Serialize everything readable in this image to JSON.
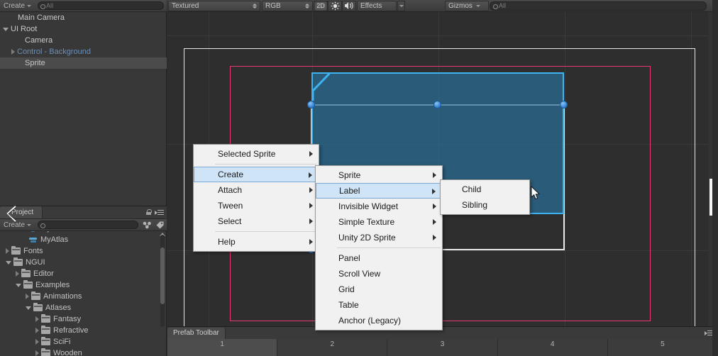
{
  "hierarchy": {
    "toolbar": {
      "create_label": "Create",
      "search_placeholder": "All"
    },
    "items": [
      {
        "label": "Main Camera",
        "indent": 14,
        "tri": "none",
        "selected": false,
        "prefab": false
      },
      {
        "label": "UI Root",
        "indent": 4,
        "tri": "down",
        "selected": false,
        "prefab": false
      },
      {
        "label": "Camera",
        "indent": 24,
        "tri": "none",
        "selected": false,
        "prefab": false
      },
      {
        "label": "Control - Background",
        "indent": 16,
        "tri": "right",
        "selected": false,
        "prefab": true
      },
      {
        "label": "Sprite",
        "indent": 24,
        "tri": "none",
        "selected": true,
        "prefab": false
      }
    ]
  },
  "project": {
    "tab_label": "Project",
    "toolbar": {
      "create_label": "Create",
      "search_placeholder": ""
    },
    "items": [
      {
        "label": "MyAtlas",
        "indent": 30,
        "tri": "none",
        "icon": "sphere",
        "clipped": true
      },
      {
        "label": "MyAtlas",
        "indent": 30,
        "tri": "none",
        "icon": "atlas",
        "clipped": false
      },
      {
        "label": "Fonts",
        "indent": 8,
        "tri": "right",
        "icon": "folder",
        "clipped": false
      },
      {
        "label": "NGUI",
        "indent": 8,
        "tri": "down",
        "icon": "folder",
        "clipped": false
      },
      {
        "label": "Editor",
        "indent": 22,
        "tri": "right",
        "icon": "folder",
        "clipped": false
      },
      {
        "label": "Examples",
        "indent": 22,
        "tri": "down",
        "icon": "folder",
        "clipped": false
      },
      {
        "label": "Animations",
        "indent": 36,
        "tri": "right",
        "icon": "folder",
        "clipped": false
      },
      {
        "label": "Atlases",
        "indent": 36,
        "tri": "down",
        "icon": "folder",
        "clipped": false
      },
      {
        "label": "Fantasy",
        "indent": 50,
        "tri": "right",
        "icon": "folder",
        "clipped": false
      },
      {
        "label": "Refractive",
        "indent": 50,
        "tri": "right",
        "icon": "folder",
        "clipped": false
      },
      {
        "label": "SciFi",
        "indent": 50,
        "tri": "right",
        "icon": "folder",
        "clipped": false
      },
      {
        "label": "Wooden",
        "indent": 50,
        "tri": "right",
        "icon": "folder",
        "clipped": true
      }
    ]
  },
  "scene_toolbar": {
    "draw_mode": "Textured",
    "color_mode": "RGB",
    "mode_2d": "2D",
    "lighting_icon": "sun-icon",
    "audio_icon": "speaker-icon",
    "effects_label": "Effects",
    "gizmos_label": "Gizmos",
    "gizmos_search_placeholder": "All"
  },
  "menus": {
    "menu1": [
      {
        "label": "Selected Sprite",
        "submenu": true,
        "highlighted": false,
        "separator_after": true
      },
      {
        "label": "Create",
        "submenu": true,
        "highlighted": true,
        "separator_after": false
      },
      {
        "label": "Attach",
        "submenu": true,
        "highlighted": false,
        "separator_after": false
      },
      {
        "label": "Tween",
        "submenu": true,
        "highlighted": false,
        "separator_after": false
      },
      {
        "label": "Select",
        "submenu": true,
        "highlighted": false,
        "separator_after": true
      },
      {
        "label": "Help",
        "submenu": true,
        "highlighted": false,
        "separator_after": false
      }
    ],
    "menu2": [
      {
        "label": "Sprite",
        "submenu": true,
        "highlighted": false,
        "separator_after": false
      },
      {
        "label": "Label",
        "submenu": true,
        "highlighted": true,
        "separator_after": false
      },
      {
        "label": "Invisible Widget",
        "submenu": true,
        "highlighted": false,
        "separator_after": false
      },
      {
        "label": "Simple Texture",
        "submenu": true,
        "highlighted": false,
        "separator_after": false
      },
      {
        "label": "Unity 2D Sprite",
        "submenu": true,
        "highlighted": false,
        "separator_after": true
      },
      {
        "label": "Panel",
        "submenu": false,
        "highlighted": false,
        "separator_after": false
      },
      {
        "label": "Scroll View",
        "submenu": false,
        "highlighted": false,
        "separator_after": false
      },
      {
        "label": "Grid",
        "submenu": false,
        "highlighted": false,
        "separator_after": false
      },
      {
        "label": "Table",
        "submenu": false,
        "highlighted": false,
        "separator_after": false
      },
      {
        "label": "Anchor (Legacy)",
        "submenu": false,
        "highlighted": false,
        "separator_after": false
      }
    ],
    "menu3": [
      {
        "label": "Child",
        "submenu": false,
        "highlighted": false,
        "separator_after": false
      },
      {
        "label": "Sibling",
        "submenu": false,
        "highlighted": false,
        "separator_after": false
      }
    ]
  },
  "prefab_toolbar": {
    "tab_label": "Prefab Toolbar",
    "cells": [
      "1",
      "2",
      "3",
      "4",
      "5"
    ]
  },
  "colors": {
    "panel_bg": "#383838",
    "scene_bg": "#2e2e2e",
    "menu_bg": "#f1f1f1",
    "menu_highlight": "#cfe4f7",
    "camera_rect": "#e8e8e8",
    "ui_rect": "#e23a72",
    "sprite_outline": "#3fb3ef",
    "sprite_fill": "#2a6e96",
    "handle": "#2f7fd4",
    "prefab_label": "#6d8fb5"
  }
}
